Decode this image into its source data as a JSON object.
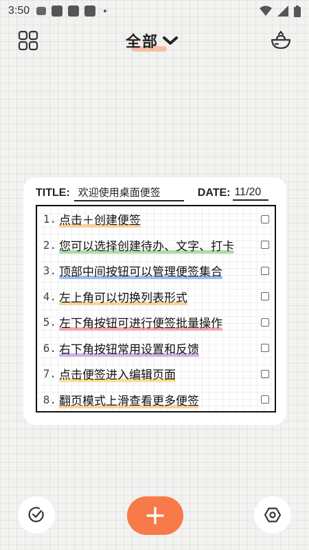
{
  "status_bar": {
    "time": "3:50"
  },
  "header": {
    "title": "全部"
  },
  "card": {
    "title_label": "TITLE:",
    "title_value": "欢迎使用桌面便签",
    "date_label": "DATE:",
    "date_value": "11/20",
    "items": [
      {
        "num": "1.",
        "text": "点击＋创建便签",
        "color": "#f8c98a"
      },
      {
        "num": "2.",
        "text": "您可以选择创建待办、文字、打卡",
        "color": "#9ad89a"
      },
      {
        "num": "3.",
        "text": "顶部中间按钮可以管理便签集合",
        "color": "#8ab4f0"
      },
      {
        "num": "4.",
        "text": "左上角可以切换列表形式",
        "color": "#f8c98a"
      },
      {
        "num": "5.",
        "text": "左下角按钮可进行便签批量操作",
        "color": "#f29aa8"
      },
      {
        "num": "6.",
        "text": "右下角按钮常用设置和反馈",
        "color": "#c9a2e6"
      },
      {
        "num": "7.",
        "text": "点击便签进入编辑页面",
        "color": "#f6dc8a"
      },
      {
        "num": "8.",
        "text": "翻页模式上滑查看更多便签",
        "color": "#f8c98a"
      }
    ]
  },
  "colors": {
    "accent": "#f77a48",
    "title_highlight": "#f4b79a"
  },
  "icons": {
    "top_left": "grid-layout-icon",
    "top_right": "bowl-icon",
    "bottom_left": "check-circle-icon",
    "bottom_center": "plus-icon",
    "bottom_right": "hexagon-settings-icon"
  }
}
